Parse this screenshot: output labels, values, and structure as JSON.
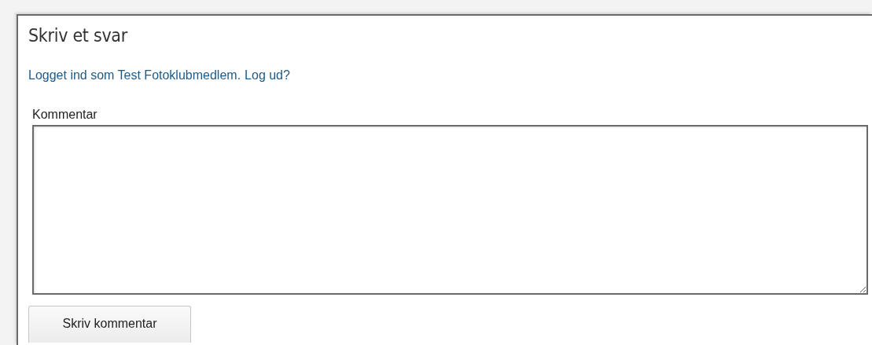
{
  "heading": "Skriv et svar",
  "logged_in": {
    "profile_link": "Logget ind som Test Fotoklubmedlem.",
    "logout_link": "Log ud?"
  },
  "comment": {
    "label": "Kommentar"
  },
  "submit_button": "Skriv kommentar"
}
